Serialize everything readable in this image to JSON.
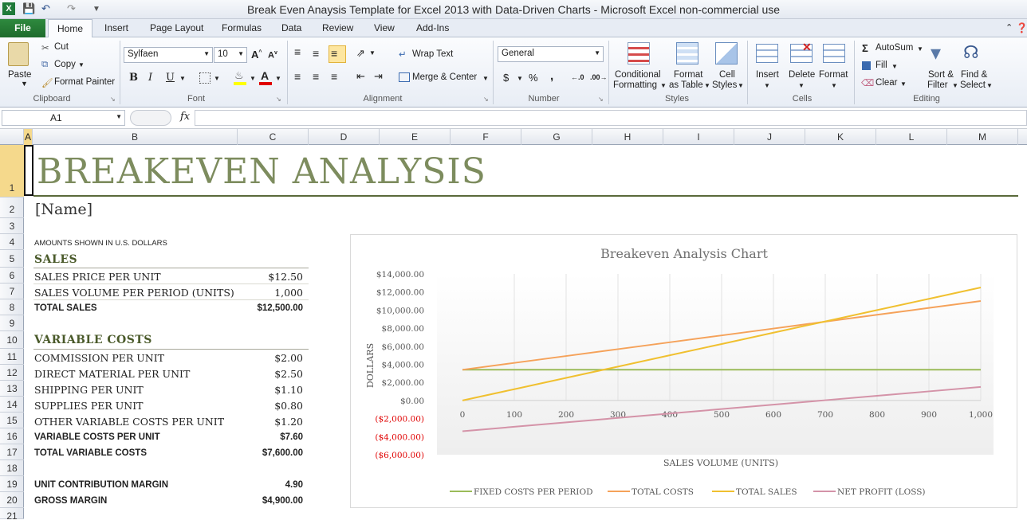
{
  "window": {
    "title": "Break Even Anaysis Template for Excel 2013 with Data-Driven Charts  -  Microsoft Excel non-commercial use"
  },
  "tabs": [
    "File",
    "Home",
    "Insert",
    "Page Layout",
    "Formulas",
    "Data",
    "Review",
    "View",
    "Add-Ins"
  ],
  "ribbon": {
    "clipboard": {
      "label": "Clipboard",
      "paste": "Paste",
      "cut": "Cut",
      "copy": "Copy",
      "format_painter": "Format Painter"
    },
    "font": {
      "label": "Font",
      "name": "Sylfaen",
      "size": "10",
      "bold": "B",
      "italic": "I",
      "underline": "U"
    },
    "alignment": {
      "label": "Alignment",
      "wrap": "Wrap Text",
      "merge": "Merge & Center"
    },
    "number": {
      "label": "Number",
      "format": "General",
      "currency": "$",
      "percent": "%",
      "comma": ","
    },
    "styles": {
      "label": "Styles",
      "conditional": [
        "Conditional",
        "Formatting"
      ],
      "format_table": [
        "Format",
        "as Table"
      ],
      "cell_styles": [
        "Cell",
        "Styles"
      ]
    },
    "cells": {
      "label": "Cells",
      "insert": "Insert",
      "delete": "Delete",
      "format": "Format"
    },
    "editing": {
      "label": "Editing",
      "autosum": "AutoSum",
      "fill": "Fill",
      "clear": "Clear",
      "sort": [
        "Sort &",
        "Filter"
      ],
      "find": [
        "Find &",
        "Select"
      ]
    }
  },
  "formula_bar": {
    "name_box": "A1",
    "fx": "fx",
    "value": ""
  },
  "columns": [
    "A",
    "B",
    "C",
    "D",
    "E",
    "F",
    "G",
    "H",
    "I",
    "J",
    "K",
    "L",
    "M"
  ],
  "rows": [
    "1",
    "2",
    "3",
    "4",
    "5",
    "6",
    "7",
    "8",
    "9",
    "10",
    "11",
    "12",
    "13",
    "14",
    "15",
    "16",
    "17",
    "18",
    "19",
    "20",
    "21"
  ],
  "sheet": {
    "title": "BREAKEVEN ANALYSIS",
    "name": "[Name]",
    "note": "AMOUNTS SHOWN IN U.S. DOLLARS",
    "sales_header": "SALES",
    "sales": [
      {
        "label": "SALES PRICE PER UNIT",
        "value": "$12.50"
      },
      {
        "label": "SALES VOLUME PER PERIOD (UNITS)",
        "value": "1,000"
      }
    ],
    "total_sales": {
      "label": "TOTAL SALES",
      "value": "$12,500.00"
    },
    "var_header": "VARIABLE COSTS",
    "variable": [
      {
        "label": "COMMISSION PER UNIT",
        "value": "$2.00"
      },
      {
        "label": "DIRECT MATERIAL PER UNIT",
        "value": "$2.50"
      },
      {
        "label": "SHIPPING PER UNIT",
        "value": "$1.10"
      },
      {
        "label": "SUPPLIES PER UNIT",
        "value": "$0.80"
      },
      {
        "label": "OTHER VARIABLE COSTS PER UNIT",
        "value": "$1.20"
      }
    ],
    "var_per_unit": {
      "label": "VARIABLE COSTS PER UNIT",
      "value": "$7.60"
    },
    "total_var": {
      "label": "TOTAL VARIABLE COSTS",
      "value": "$7,600.00"
    },
    "ucm": {
      "label": "UNIT CONTRIBUTION MARGIN",
      "value": "4.90"
    },
    "gross": {
      "label": "GROSS MARGIN",
      "value": "$4,900.00"
    }
  },
  "chart_data": {
    "type": "line",
    "title": "Breakeven Analysis Chart",
    "xlabel": "SALES VOLUME (UNITS)",
    "ylabel": "DOLLARS",
    "x": [
      0,
      100,
      200,
      300,
      400,
      500,
      600,
      700,
      800,
      900,
      1000
    ],
    "x_tick_labels": [
      "0",
      "100",
      "200",
      "300",
      "400",
      "500",
      "600",
      "700",
      "800",
      "900",
      "1,000"
    ],
    "ylim": [
      -6000,
      14000
    ],
    "y_ticks": [
      -6000,
      -4000,
      -2000,
      0,
      2000,
      4000,
      6000,
      8000,
      10000,
      12000,
      14000
    ],
    "y_tick_labels": [
      "($6,000.00)",
      "($4,000.00)",
      "($2,000.00)",
      "$0.00",
      "$2,000.00",
      "$4,000.00",
      "$6,000.00",
      "$8,000.00",
      "$10,000.00",
      "$12,000.00",
      "$14,000.00"
    ],
    "grid": "vertical",
    "legend": "bottom",
    "series": [
      {
        "name": "FIXED COSTS PER PERIOD",
        "color": "#9bbb59",
        "values": [
          3400,
          3400,
          3400,
          3400,
          3400,
          3400,
          3400,
          3400,
          3400,
          3400,
          3400
        ]
      },
      {
        "name": "TOTAL COSTS",
        "color": "#f5a25a",
        "values": [
          3400,
          4160,
          4920,
          5680,
          6440,
          7200,
          7960,
          8720,
          9480,
          10240,
          11000
        ]
      },
      {
        "name": "TOTAL SALES",
        "color": "#f0c030",
        "values": [
          0,
          1250,
          2500,
          3750,
          5000,
          6250,
          7500,
          8750,
          10000,
          11250,
          12500
        ]
      },
      {
        "name": "NET PROFIT (LOSS)",
        "color": "#d493a8",
        "values": [
          -3400,
          -2910,
          -2420,
          -1930,
          -1440,
          -950,
          -460,
          30,
          520,
          1010,
          1500
        ]
      }
    ]
  }
}
